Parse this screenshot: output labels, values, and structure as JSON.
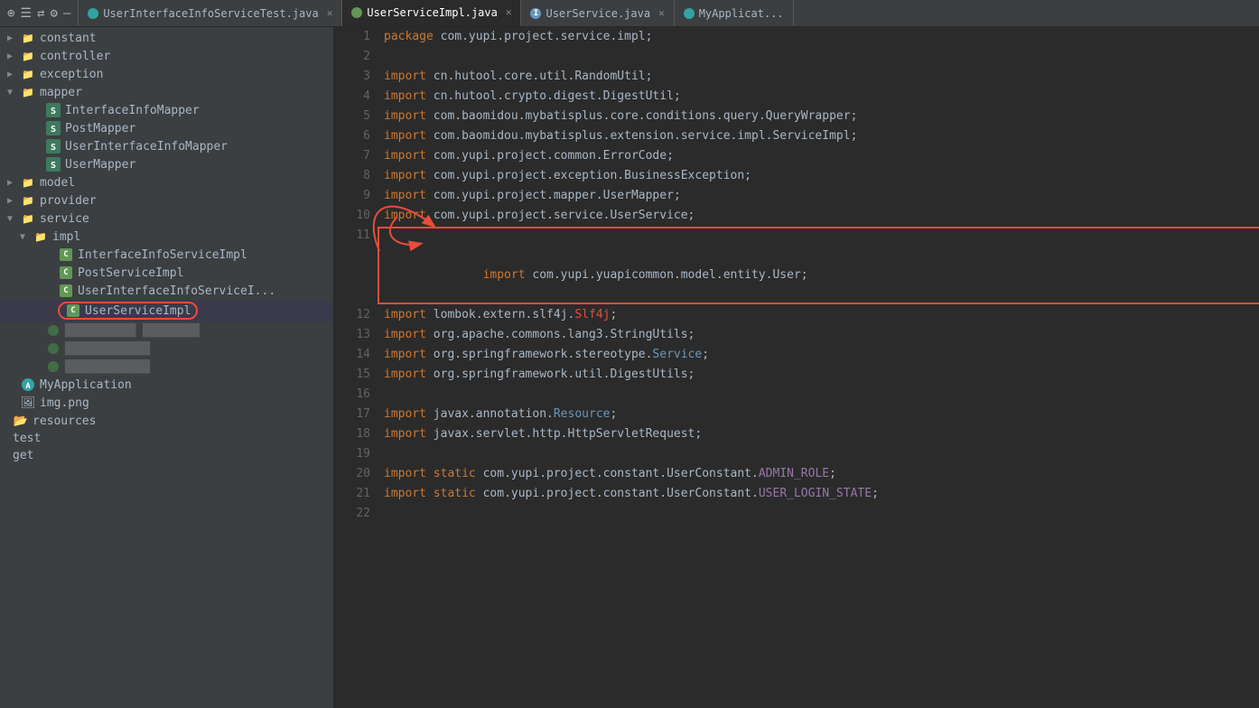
{
  "tabBar": {
    "icons": [
      "⊕",
      "≡",
      "⇄",
      "⚙",
      "—"
    ],
    "tabs": [
      {
        "id": "tab-test",
        "label": "UserInterfaceInfoServiceTest.java",
        "type": "test",
        "active": false,
        "closable": true
      },
      {
        "id": "tab-impl",
        "label": "UserServiceImpl.java",
        "type": "c",
        "active": true,
        "closable": true
      },
      {
        "id": "tab-service",
        "label": "UserService.java",
        "type": "i",
        "active": false,
        "closable": true
      },
      {
        "id": "tab-app",
        "label": "MyApplicat...",
        "type": "app",
        "active": false,
        "closable": false
      }
    ]
  },
  "sidebar": {
    "items": [
      {
        "id": "constant",
        "label": "constant",
        "type": "folder",
        "indent": 0,
        "expanded": false
      },
      {
        "id": "controller",
        "label": "controller",
        "type": "folder",
        "indent": 0,
        "expanded": false
      },
      {
        "id": "exception",
        "label": "exception",
        "type": "folder",
        "indent": 0,
        "expanded": false
      },
      {
        "id": "mapper",
        "label": "mapper",
        "type": "folder",
        "indent": 0,
        "expanded": true
      },
      {
        "id": "InterfaceInfoMapper",
        "label": "InterfaceInfoMapper",
        "type": "class",
        "indent": 2
      },
      {
        "id": "PostMapper",
        "label": "PostMapper",
        "type": "class",
        "indent": 2
      },
      {
        "id": "UserInterfaceInfoMapper",
        "label": "UserInterfaceInfoMapper",
        "type": "class",
        "indent": 2
      },
      {
        "id": "UserMapper",
        "label": "UserMapper",
        "type": "class",
        "indent": 2
      },
      {
        "id": "model",
        "label": "model",
        "type": "folder",
        "indent": 0,
        "expanded": false
      },
      {
        "id": "provider",
        "label": "provider",
        "type": "folder",
        "indent": 0,
        "expanded": false
      },
      {
        "id": "service",
        "label": "service",
        "type": "folder",
        "indent": 0,
        "expanded": true
      },
      {
        "id": "impl",
        "label": "impl",
        "type": "folder",
        "indent": 1,
        "expanded": true
      },
      {
        "id": "InterfaceInfoServiceImpl",
        "label": "InterfaceInfoServiceImpl",
        "type": "class-c",
        "indent": 3
      },
      {
        "id": "PostServiceImpl",
        "label": "PostServiceImpl",
        "type": "class-c",
        "indent": 3
      },
      {
        "id": "UserInterfaceInfoServiceI",
        "label": "UserInterfaceInfoServiceI...",
        "type": "class-c",
        "indent": 3
      },
      {
        "id": "UserServiceImpl",
        "label": "UserServiceImpl",
        "type": "class-c",
        "indent": 3,
        "selected": true
      },
      {
        "id": "service1",
        "label": "■■■■■■■■■ ■■■■■■■",
        "type": "green-dot",
        "indent": 2
      },
      {
        "id": "service2",
        "label": "■■■■■■■■■■■",
        "type": "green-dot",
        "indent": 2
      },
      {
        "id": "service3",
        "label": "■■■■■■■■■■■",
        "type": "green-dot",
        "indent": 2
      },
      {
        "id": "MyApplication",
        "label": "MyApplication",
        "type": "app",
        "indent": 0
      },
      {
        "id": "img",
        "label": "img.png",
        "type": "img",
        "indent": 0
      },
      {
        "id": "resources",
        "label": "resources",
        "type": "folder",
        "indent": 0
      },
      {
        "id": "test",
        "label": "test",
        "type": "plain",
        "indent": 0
      },
      {
        "id": "target",
        "label": "get",
        "type": "plain",
        "indent": 0
      }
    ]
  },
  "editor": {
    "lines": [
      {
        "num": 1,
        "content": "package com.yupi.project.service.impl;"
      },
      {
        "num": 2,
        "content": ""
      },
      {
        "num": 3,
        "content": "import cn.hutool.core.util.RandomUtil;"
      },
      {
        "num": 4,
        "content": "import cn.hutool.crypto.digest.DigestUtil;"
      },
      {
        "num": 5,
        "content": "import com.baomidou.mybatisplus.core.conditions.query.QueryWrapper;"
      },
      {
        "num": 6,
        "content": "import com.baomidou.mybatisplus.extension.service.impl.ServiceImpl;"
      },
      {
        "num": 7,
        "content": "import com.yupi.project.common.ErrorCode;"
      },
      {
        "num": 8,
        "content": "import com.yupi.project.exception.BusinessException;"
      },
      {
        "num": 9,
        "content": "import com.yupi.project.mapper.UserMapper;"
      },
      {
        "num": 10,
        "content": "import com.yupi.project.service.UserService;"
      },
      {
        "num": 11,
        "content": "import com.yupi.yuapicommon.model.entity.User;",
        "highlight": true
      },
      {
        "num": 12,
        "content": "import lombok.extern.slf4j.Slf4j;"
      },
      {
        "num": 13,
        "content": "import org.apache.commons.lang3.StringUtils;"
      },
      {
        "num": 14,
        "content": "import org.springframework.stereotype.Service;"
      },
      {
        "num": 15,
        "content": "import org.springframework.util.DigestUtils;"
      },
      {
        "num": 16,
        "content": ""
      },
      {
        "num": 17,
        "content": "import javax.annotation.Resource;"
      },
      {
        "num": 18,
        "content": "import javax.servlet.http.HttpServletRequest;"
      },
      {
        "num": 19,
        "content": ""
      },
      {
        "num": 20,
        "content": "import static com.yupi.project.constant.UserConstant.ADMIN_ROLE;"
      },
      {
        "num": 21,
        "content": "import static com.yupi.project.constant.UserConstant.USER_LOGIN_STATE;"
      },
      {
        "num": 22,
        "content": ""
      }
    ]
  }
}
